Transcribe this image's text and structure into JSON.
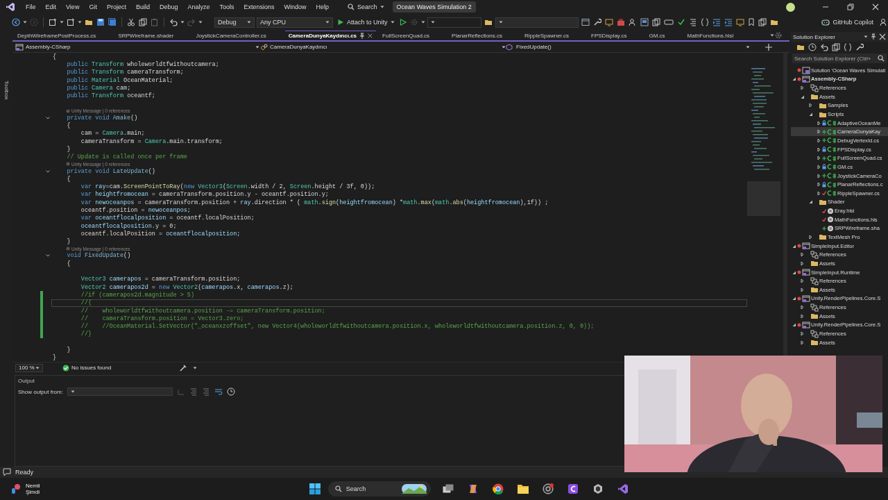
{
  "window": {
    "title": "Ocean Waves Simulation 2"
  },
  "menu": [
    "File",
    "Edit",
    "View",
    "Git",
    "Project",
    "Build",
    "Debug",
    "Analyze",
    "Tools",
    "Extensions",
    "Window",
    "Help"
  ],
  "search": {
    "label": "Search"
  },
  "toolbar": {
    "configuration": "Debug",
    "platform": "Any CPU",
    "run_target": "Attach to Unity",
    "copilot": "GitHub Copilot"
  },
  "toolbox": {
    "label": "Toolbox"
  },
  "tabs": [
    {
      "label": "DepthWireframePostProcess.cs",
      "selected": false
    },
    {
      "label": "SRPWireframe.shader",
      "selected": false
    },
    {
      "label": "JoystickCameraController.cs",
      "selected": false
    },
    {
      "label": "CameraDunyaKaydıncı.cs",
      "selected": true
    },
    {
      "label": "FullScreenQuad.cs",
      "selected": false
    },
    {
      "label": "PlanarReflections.cs",
      "selected": false
    },
    {
      "label": "RippleSpawner.cs",
      "selected": false
    },
    {
      "label": "FPSDisplay.cs",
      "selected": false
    },
    {
      "label": "GM.cs",
      "selected": false
    },
    {
      "label": "MathFunctions.hlsl",
      "selected": false
    }
  ],
  "navigation": {
    "project": "Assembly-CSharp",
    "type": "CameraDunyaKaydıncı",
    "member": "FixedUpdate()"
  },
  "code": [
    {
      "kind": "code",
      "tokens": [
        {
          "text": "{",
          "kind": "plain"
        }
      ]
    },
    {
      "kind": "code",
      "tokens": [
        {
          "text": "    public ",
          "kind": "keyword"
        },
        {
          "text": "Transform ",
          "kind": "type"
        },
        {
          "text": "wholeworldtfwithoutcamera;",
          "kind": "plain"
        }
      ]
    },
    {
      "kind": "code",
      "tokens": [
        {
          "text": "    public ",
          "kind": "keyword"
        },
        {
          "text": "Transform ",
          "kind": "type"
        },
        {
          "text": "cameraTransform;",
          "kind": "plain"
        }
      ]
    },
    {
      "kind": "code",
      "tokens": [
        {
          "text": "    public ",
          "kind": "keyword"
        },
        {
          "text": "Material ",
          "kind": "type"
        },
        {
          "text": "OceanMaterial;",
          "kind": "plain"
        }
      ]
    },
    {
      "kind": "code",
      "tokens": [
        {
          "text": "    public ",
          "kind": "keyword"
        },
        {
          "text": "Camera ",
          "kind": "type"
        },
        {
          "text": "cam;",
          "kind": "plain"
        }
      ]
    },
    {
      "kind": "code",
      "tokens": [
        {
          "text": "    public ",
          "kind": "keyword"
        },
        {
          "text": "Transform ",
          "kind": "type"
        },
        {
          "text": "oceantf;",
          "kind": "plain"
        }
      ]
    },
    {
      "kind": "blank"
    },
    {
      "kind": "lens",
      "text": "Unity Message | 0 references"
    },
    {
      "kind": "code",
      "fold": true,
      "tokens": [
        {
          "text": "    private void ",
          "kind": "keyword"
        },
        {
          "text": "Amake",
          "kind": "method"
        },
        {
          "text": "()",
          "kind": "plain"
        }
      ]
    },
    {
      "kind": "code",
      "tokens": [
        {
          "text": "    {",
          "kind": "plain"
        }
      ]
    },
    {
      "kind": "code",
      "tokens": [
        {
          "text": "        cam = ",
          "kind": "plain"
        },
        {
          "text": "Camera",
          "kind": "type"
        },
        {
          "text": ".main;",
          "kind": "plain"
        }
      ]
    },
    {
      "kind": "code",
      "tokens": [
        {
          "text": "        cameraTransform = ",
          "kind": "plain"
        },
        {
          "text": "Camera",
          "kind": "type"
        },
        {
          "text": ".main.transform;",
          "kind": "plain"
        }
      ]
    },
    {
      "kind": "code",
      "tokens": [
        {
          "text": "    }",
          "kind": "plain"
        }
      ]
    },
    {
      "kind": "code",
      "tokens": [
        {
          "text": "    // Update is called once per frame",
          "kind": "comment"
        }
      ]
    },
    {
      "kind": "lens",
      "text": "Unity Message | 0 references"
    },
    {
      "kind": "code",
      "fold": true,
      "tokens": [
        {
          "text": "    private void ",
          "kind": "keyword"
        },
        {
          "text": "LateUpdate",
          "kind": "method"
        },
        {
          "text": "()",
          "kind": "plain"
        }
      ]
    },
    {
      "kind": "code",
      "tokens": [
        {
          "text": "    {",
          "kind": "plain"
        }
      ]
    },
    {
      "kind": "code",
      "tokens": [
        {
          "text": "        var ",
          "kind": "keyword"
        },
        {
          "text": "ray",
          "kind": "local"
        },
        {
          "text": "=cam.",
          "kind": "plain"
        },
        {
          "text": "ScreenPointToRay",
          "kind": "function"
        },
        {
          "text": "(",
          "kind": "plain"
        },
        {
          "text": "new ",
          "kind": "keyword"
        },
        {
          "text": "Vector3",
          "kind": "type"
        },
        {
          "text": "(",
          "kind": "plain"
        },
        {
          "text": "Screen",
          "kind": "type"
        },
        {
          "text": ".width / 2, ",
          "kind": "plain"
        },
        {
          "text": "Screen",
          "kind": "type"
        },
        {
          "text": ".height / 3f, 0));",
          "kind": "plain"
        }
      ]
    },
    {
      "kind": "code",
      "tokens": [
        {
          "text": "        var ",
          "kind": "keyword"
        },
        {
          "text": "heightfromocean",
          "kind": "local"
        },
        {
          "text": " = cameraTransform.position.y - oceantf.position.y;",
          "kind": "plain"
        }
      ]
    },
    {
      "kind": "code",
      "tokens": [
        {
          "text": "        var ",
          "kind": "keyword"
        },
        {
          "text": "newoceanpos",
          "kind": "local"
        },
        {
          "text": " = cameraTransform.position + ",
          "kind": "plain"
        },
        {
          "text": "ray",
          "kind": "local"
        },
        {
          "text": ".direction * ( ",
          "kind": "plain"
        },
        {
          "text": "math",
          "kind": "type"
        },
        {
          "text": ".",
          "kind": "plain"
        },
        {
          "text": "sign",
          "kind": "function"
        },
        {
          "text": "(",
          "kind": "plain"
        },
        {
          "text": "heightfromocean",
          "kind": "local"
        },
        {
          "text": ") *",
          "kind": "plain"
        },
        {
          "text": "math",
          "kind": "type"
        },
        {
          "text": ".",
          "kind": "plain"
        },
        {
          "text": "max",
          "kind": "function"
        },
        {
          "text": "(",
          "kind": "plain"
        },
        {
          "text": "math",
          "kind": "type"
        },
        {
          "text": ".",
          "kind": "plain"
        },
        {
          "text": "abs",
          "kind": "function"
        },
        {
          "text": "(",
          "kind": "plain"
        },
        {
          "text": "heightfromocean",
          "kind": "local"
        },
        {
          "text": "),1f)) ;",
          "kind": "plain"
        }
      ]
    },
    {
      "kind": "code",
      "tokens": [
        {
          "text": "        oceantf.position = ",
          "kind": "plain"
        },
        {
          "text": "newoceanpos",
          "kind": "local"
        },
        {
          "text": ";",
          "kind": "plain"
        }
      ]
    },
    {
      "kind": "code",
      "tokens": [
        {
          "text": "        var ",
          "kind": "keyword"
        },
        {
          "text": "oceantflocalposition",
          "kind": "local"
        },
        {
          "text": " = oceantf.localPosition;",
          "kind": "plain"
        }
      ]
    },
    {
      "kind": "code",
      "tokens": [
        {
          "text": "        oceantflocalposition",
          "kind": "local"
        },
        {
          "text": ".y = 0;",
          "kind": "plain"
        }
      ]
    },
    {
      "kind": "code",
      "tokens": [
        {
          "text": "        oceantf.localPosition = ",
          "kind": "plain"
        },
        {
          "text": "oceantflocalposition",
          "kind": "local"
        },
        {
          "text": ";",
          "kind": "plain"
        }
      ]
    },
    {
      "kind": "code",
      "tokens": [
        {
          "text": "    }",
          "kind": "plain"
        }
      ]
    },
    {
      "kind": "lens",
      "text": "Unity Message | 0 references"
    },
    {
      "kind": "code",
      "fold": true,
      "tokens": [
        {
          "text": "    void ",
          "kind": "keyword"
        },
        {
          "text": "FixedUpdate",
          "kind": "method"
        },
        {
          "text": "()",
          "kind": "plain"
        }
      ]
    },
    {
      "kind": "code",
      "tokens": [
        {
          "text": "    {",
          "kind": "plain"
        }
      ]
    },
    {
      "kind": "blank"
    },
    {
      "kind": "code",
      "tokens": [
        {
          "text": "        Vector3 ",
          "kind": "type"
        },
        {
          "text": "camerapos",
          "kind": "local"
        },
        {
          "text": " = cameraTransform.position;",
          "kind": "plain"
        }
      ]
    },
    {
      "kind": "code",
      "tokens": [
        {
          "text": "        Vector2 ",
          "kind": "type"
        },
        {
          "text": "camerapos2d",
          "kind": "local"
        },
        {
          "text": " = ",
          "kind": "plain"
        },
        {
          "text": "new ",
          "kind": "keyword"
        },
        {
          "text": "Vector2",
          "kind": "type"
        },
        {
          "text": "(",
          "kind": "plain"
        },
        {
          "text": "camerapos",
          "kind": "local"
        },
        {
          "text": ".x, ",
          "kind": "plain"
        },
        {
          "text": "camerapos",
          "kind": "local"
        },
        {
          "text": ".z);",
          "kind": "plain"
        }
      ]
    },
    {
      "kind": "code",
      "changed": true,
      "tokens": [
        {
          "text": "        //if (camerapos2d.magnitude > 5)",
          "kind": "comment"
        }
      ]
    },
    {
      "kind": "code",
      "changed": true,
      "current": true,
      "tokens": [
        {
          "text": "        //{",
          "kind": "comment"
        }
      ]
    },
    {
      "kind": "code",
      "changed": true,
      "tokens": [
        {
          "text": "        //    wholeworldtfwithoutcamera.position -= cameraTransform.position;",
          "kind": "comment"
        }
      ]
    },
    {
      "kind": "code",
      "changed": true,
      "tokens": [
        {
          "text": "        //    cameraTransform.position = Vector3.zero;",
          "kind": "comment"
        }
      ]
    },
    {
      "kind": "code",
      "changed": true,
      "tokens": [
        {
          "text": "        //    //OceanMaterial.SetVector(\"_oceanxzoffset\", new Vector4(wholeworldtfwithoutcamera.position.x, wholeworldtfwithoutcamera.position.z, 0, 0));",
          "kind": "comment"
        }
      ]
    },
    {
      "kind": "code",
      "changed": true,
      "tokens": [
        {
          "text": "        //}",
          "kind": "comment"
        }
      ]
    },
    {
      "kind": "blank"
    },
    {
      "kind": "code",
      "tokens": [
        {
          "text": "    }",
          "kind": "plain"
        }
      ]
    },
    {
      "kind": "code",
      "tokens": [
        {
          "text": "}",
          "kind": "plain"
        }
      ]
    }
  ],
  "editor_status": {
    "zoom": "100 %",
    "issues": "No issues found"
  },
  "output": {
    "title": "Output",
    "show_from_label": "Show output from:"
  },
  "solution_explorer": {
    "title": "Solution Explorer",
    "search": {
      "placeholder": "Search Solution Explorer (Ctrl+"
    },
    "tree": [
      {
        "label": "Solution 'Ocean Waves Simulati",
        "kind": "solution",
        "modified": true,
        "selected": false
      },
      {
        "label": "Assembly-CSharp",
        "kind": "project",
        "modified": true,
        "startup": true,
        "expanded": true,
        "selected": false,
        "children": [
          {
            "label": "References",
            "kind": "references",
            "expanded": false,
            "selected": false
          },
          {
            "label": "Assets",
            "kind": "folder",
            "expanded": true,
            "selected": false,
            "children": [
              {
                "label": "Samples",
                "kind": "folder",
                "expanded": false,
                "selected": false
              },
              {
                "label": "Scripts",
                "kind": "folder",
                "expanded": true,
                "selected": false,
                "children": [
                  {
                    "label": "AdaptiveOceanMe",
                    "kind": "csharp",
                    "locked": true,
                    "expanded": false,
                    "selected": false
                  },
                  {
                    "label": "CameraDunyaKay",
                    "kind": "csharp",
                    "added": true,
                    "expanded": false,
                    "selected": true
                  },
                  {
                    "label": "DebugVertexId.cs",
                    "kind": "csharp",
                    "added": true,
                    "expanded": false,
                    "selected": false
                  },
                  {
                    "label": "FPSDisplay.cs",
                    "kind": "csharp",
                    "locked": true,
                    "expanded": false,
                    "selected": false
                  },
                  {
                    "label": "FullScreenQuad.cs",
                    "kind": "csharp",
                    "added": true,
                    "expanded": false,
                    "selected": false
                  },
                  {
                    "label": "GM.cs",
                    "kind": "csharp",
                    "locked": true,
                    "expanded": false,
                    "selected": false
                  },
                  {
                    "label": "JoystickCameraCo",
                    "kind": "csharp",
                    "added": true,
                    "expanded": false,
                    "selected": false
                  },
                  {
                    "label": "PlanarReflections.c",
                    "kind": "csharp",
                    "locked": true,
                    "expanded": false,
                    "selected": false
                  },
                  {
                    "label": "RippleSpawner.cs",
                    "kind": "csharp",
                    "modified": true,
                    "expanded": false,
                    "selected": false
                  }
                ]
              },
              {
                "label": "Shader",
                "kind": "folder",
                "expanded": true,
                "selected": false,
                "children": [
                  {
                    "label": "Eray.hlsl",
                    "kind": "shader",
                    "modified": true,
                    "selected": false
                  },
                  {
                    "label": "MathFunctions.hls",
                    "kind": "shader",
                    "modified": true,
                    "selected": false
                  },
                  {
                    "label": "SRPWireframe.sha",
                    "kind": "shader",
                    "added": true,
                    "selected": false
                  }
                ]
              },
              {
                "label": "TextMesh Pro",
                "kind": "folder",
                "expanded": false,
                "selected": false
              }
            ]
          }
        ]
      },
      {
        "label": "SimpleInput.Editor",
        "kind": "project",
        "modified": true,
        "expanded": true,
        "selected": false,
        "children": [
          {
            "label": "References",
            "kind": "references",
            "expanded": false,
            "selected": false
          },
          {
            "label": "Assets",
            "kind": "folder",
            "expanded": false,
            "selected": false
          }
        ]
      },
      {
        "label": "SimpleInput.Runtime",
        "kind": "project",
        "modified": true,
        "expanded": true,
        "selected": false,
        "children": [
          {
            "label": "References",
            "kind": "references",
            "expanded": false,
            "selected": false
          },
          {
            "label": "Assets",
            "kind": "folder",
            "expanded": false,
            "selected": false
          }
        ]
      },
      {
        "label": "Unity.RenderPipelines.Core.S",
        "kind": "project",
        "modified": true,
        "expanded": true,
        "selected": false,
        "children": [
          {
            "label": "References",
            "kind": "references",
            "expanded": false,
            "selected": false
          },
          {
            "label": "Assets",
            "kind": "folder",
            "expanded": false,
            "selected": false
          }
        ]
      },
      {
        "label": "Unity.RenderPipelines.Core.S",
        "kind": "project",
        "modified": true,
        "expanded": true,
        "selected": false,
        "children": [
          {
            "label": "References",
            "kind": "references",
            "expanded": false,
            "selected": false
          },
          {
            "label": "Assets",
            "kind": "folder",
            "expanded": false,
            "selected": false
          }
        ]
      }
    ]
  },
  "status_bar": {
    "text": "Ready"
  },
  "taskbar": {
    "weather": "Nemli",
    "weather_time": "Şimdi",
    "search": "Search"
  }
}
